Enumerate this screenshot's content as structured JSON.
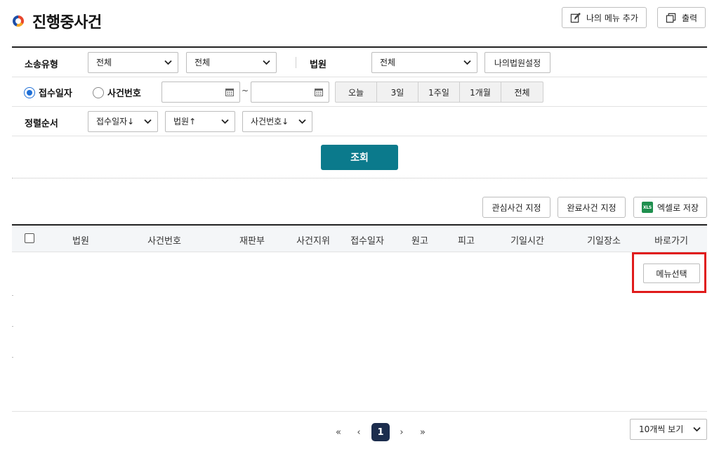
{
  "header": {
    "title": "진행중사건",
    "my_menu_add": "나의 메뉴 추가",
    "print": "출력"
  },
  "search": {
    "case_type_label": "소송유형",
    "case_type_1": "전체",
    "case_type_2": "전체",
    "court_label": "법원",
    "court_value": "전체",
    "my_court_setting": "나의법원설정",
    "radio_received": "접수일자",
    "radio_case_number": "사건번호",
    "date_separator": "~",
    "date_from": "",
    "date_to": "",
    "periods": [
      "오늘",
      "3일",
      "1주일",
      "1개월",
      "전체"
    ],
    "sort_label": "정렬순서",
    "sort_received": "접수일자↓",
    "sort_court": "법원↑",
    "sort_case_number": "사건번호↓",
    "query_button": "조회"
  },
  "actions": {
    "interest_case": "관심사건 지정",
    "completed_case": "완료사건 지정",
    "excel_save": "엑셀로 저장",
    "excel_badge": "XLS"
  },
  "table": {
    "columns": [
      "법원",
      "사건번호",
      "재판부",
      "사건지위",
      "접수일자",
      "원고",
      "피고",
      "기일시간",
      "기일장소",
      "바로가기"
    ],
    "menu_select": "메뉴선택"
  },
  "pagination": {
    "first": "«",
    "prev": "‹",
    "current": "1",
    "next": "›",
    "last": "»",
    "per_page": "10개씩 보기"
  },
  "colors": {
    "accent": "#0b7a8c",
    "page_current": "#1c2d4d",
    "highlight": "#e01b1b",
    "radio": "#1f6fd6",
    "excel": "#1f8f4e"
  }
}
